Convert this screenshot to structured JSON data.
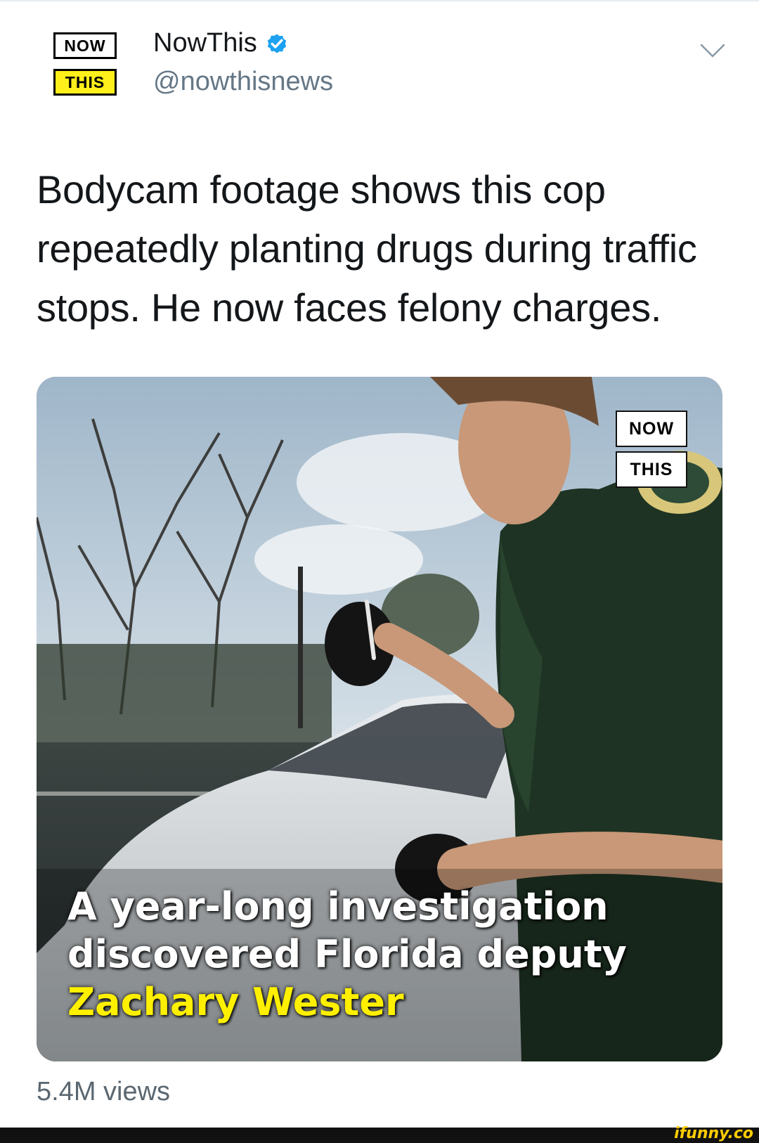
{
  "account": {
    "logo_top": "NOW",
    "logo_bottom": "THIS",
    "display_name": "NowThis",
    "handle": "@nowthisnews",
    "verified_color": "#1da1f2",
    "logo_yellow": "#ffef1a"
  },
  "tweet": {
    "text": "Bodycam footage shows this cop repeatedly planting drugs during traffic stops. He now faces felony charges."
  },
  "media": {
    "watermark_top": "NOW",
    "watermark_bottom": "THIS",
    "caption": {
      "line1": "A year-long investigation",
      "line2": "discovered Florida deputy",
      "line3": "Zachary Wester"
    },
    "caption_highlight_color": "#fff000"
  },
  "stats": {
    "views": "5.4M views"
  },
  "footer": {
    "watermark": "ifunny.co"
  },
  "icons": {
    "verified": "verified-badge-icon",
    "menu": "chevron-down-icon"
  }
}
